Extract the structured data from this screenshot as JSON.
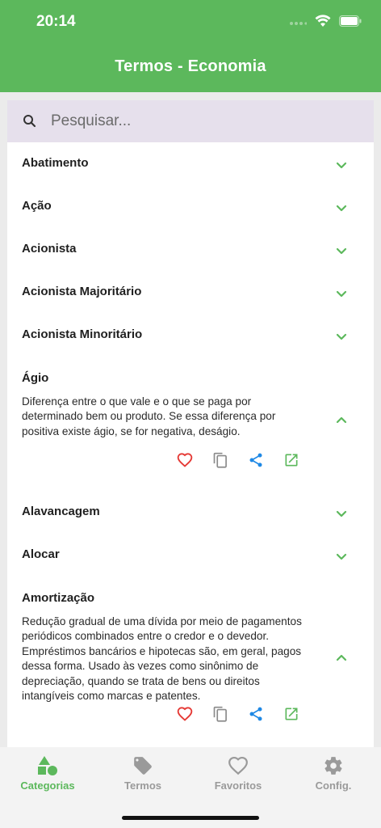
{
  "status": {
    "time": "20:14"
  },
  "appbar": {
    "title": "Termos - Economia"
  },
  "search": {
    "placeholder": "Pesquisar..."
  },
  "terms": [
    {
      "name": "Abatimento"
    },
    {
      "name": "Ação"
    },
    {
      "name": "Acionista"
    },
    {
      "name": "Acionista Majoritário"
    },
    {
      "name": "Acionista Minoritário"
    },
    {
      "name": "Ágio",
      "description": "Diferença entre o que vale e o que se paga por determinado bem ou produto. Se essa diferença por positiva existe ágio, se for negativa, deságio."
    },
    {
      "name": "Alavancagem"
    },
    {
      "name": "Alocar"
    },
    {
      "name": "Amortização",
      "description": "Redução gradual de uma dívida por meio de pagamentos periódicos combinados entre o credor e o devedor. Empréstimos bancários e hipotecas são, em geral, pagos dessa forma. Usado às vezes como sinônimo de depreciação, quando se trata de bens ou direitos intangíveis como marcas e patentes."
    }
  ],
  "nav": [
    {
      "label": "Categorias"
    },
    {
      "label": "Termos"
    },
    {
      "label": "Favoritos"
    },
    {
      "label": "Config."
    }
  ],
  "colors": {
    "primary": "#5cb85c",
    "favorite": "#e53935",
    "share": "#1e88e5",
    "copy": "#8a8a8a"
  }
}
